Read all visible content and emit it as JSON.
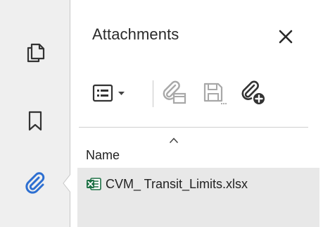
{
  "panel": {
    "title": "Attachments",
    "close_glyph": "✕"
  },
  "rail": {
    "items": [
      {
        "name": "pages-icon",
        "selected": false
      },
      {
        "name": "bookmark-icon",
        "selected": false
      },
      {
        "name": "paperclip-icon",
        "selected": true
      }
    ]
  },
  "toolbar": {
    "buttons": [
      {
        "name": "view-options-icon",
        "enabled": true
      },
      {
        "name": "open-attachment-icon",
        "enabled": false
      },
      {
        "name": "save-attachment-icon",
        "enabled": false
      },
      {
        "name": "add-attachment-icon",
        "enabled": true
      }
    ]
  },
  "list": {
    "column_name": "Name",
    "sort": "ascending",
    "files": [
      {
        "name": "CVM_ Transit_Limits.xlsx",
        "type": "excel"
      }
    ]
  },
  "colors": {
    "rail_bg": "#efefef",
    "list_bg": "#e8e8e8",
    "selected_accent": "#2d6fd1",
    "excel_green": "#1e7145",
    "disabled": "#a8a8a8"
  }
}
